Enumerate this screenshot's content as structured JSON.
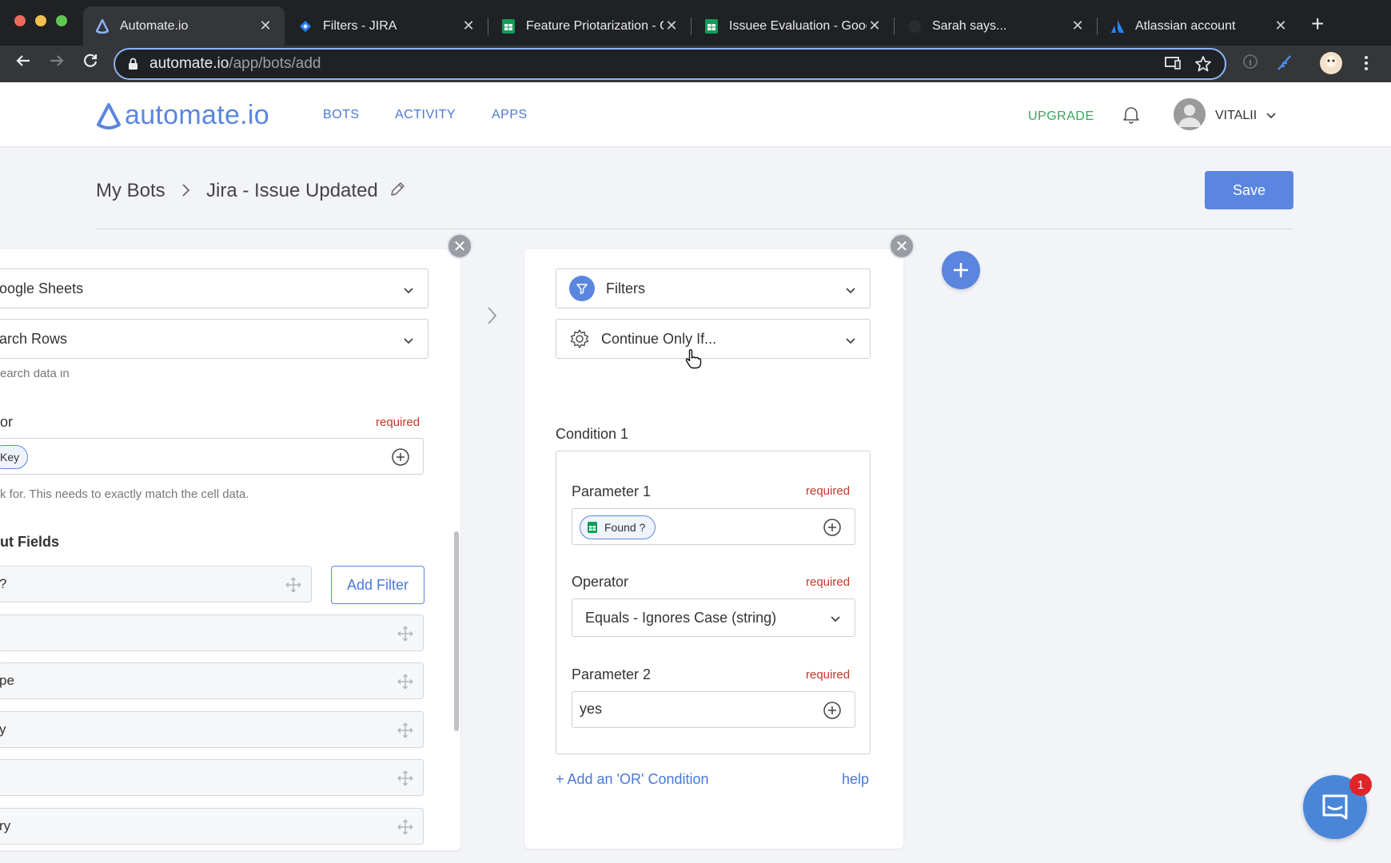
{
  "browser": {
    "tabs": [
      {
        "title": "Automate.io",
        "favicon": "automate-logo"
      },
      {
        "title": "Filters - JIRA",
        "favicon": "jira-logo"
      },
      {
        "title": "Feature Priotarization - Google Sheets",
        "favicon": "sheets-logo"
      },
      {
        "title": "Issuee Evaluation - Google Sheets",
        "favicon": "sheets-logo"
      },
      {
        "title": "Sarah says...",
        "favicon": "github-logo"
      },
      {
        "title": "Atlassian account",
        "favicon": "atlassian-logo"
      }
    ],
    "url_domain": "automate.io",
    "url_path": "/app/bots/add"
  },
  "header": {
    "logo_text": "automate.io",
    "nav": [
      "BOTS",
      "ACTIVITY",
      "APPS"
    ],
    "upgrade": "UPGRADE",
    "user_name": "VITALII"
  },
  "page": {
    "breadcrumb_root": "My Bots",
    "bot_name": "Jira - Issue Updated",
    "save_label": "Save"
  },
  "left_card": {
    "app_select": "oogle Sheets",
    "action_select": "arch Rows",
    "cut_help": "earch data in",
    "search_label": "or",
    "required": "required",
    "search_chip": "Key",
    "search_help": "k for. This needs to exactly match the cell data.",
    "output_heading": "ut Fields",
    "output_fields": [
      "?",
      "",
      "pe",
      "y",
      "",
      "ry"
    ],
    "add_filter": "Add Filter"
  },
  "right_card": {
    "app_select": "Filters",
    "action_select": "Continue Only If...",
    "condition_title": "Condition 1",
    "param1_label": "Parameter 1",
    "param1_chip": "Found ?",
    "operator_label": "Operator",
    "operator_value": "Equals - Ignores Case (string)",
    "param2_label": "Parameter 2",
    "param2_value": "yes",
    "required": "required",
    "add_or": "+ Add an 'OR' Condition",
    "help": "help"
  },
  "chat": {
    "badge": "1"
  },
  "colors": {
    "accent": "#5a86e0",
    "upgrade": "#3aa35a",
    "required": "#c0392b"
  }
}
